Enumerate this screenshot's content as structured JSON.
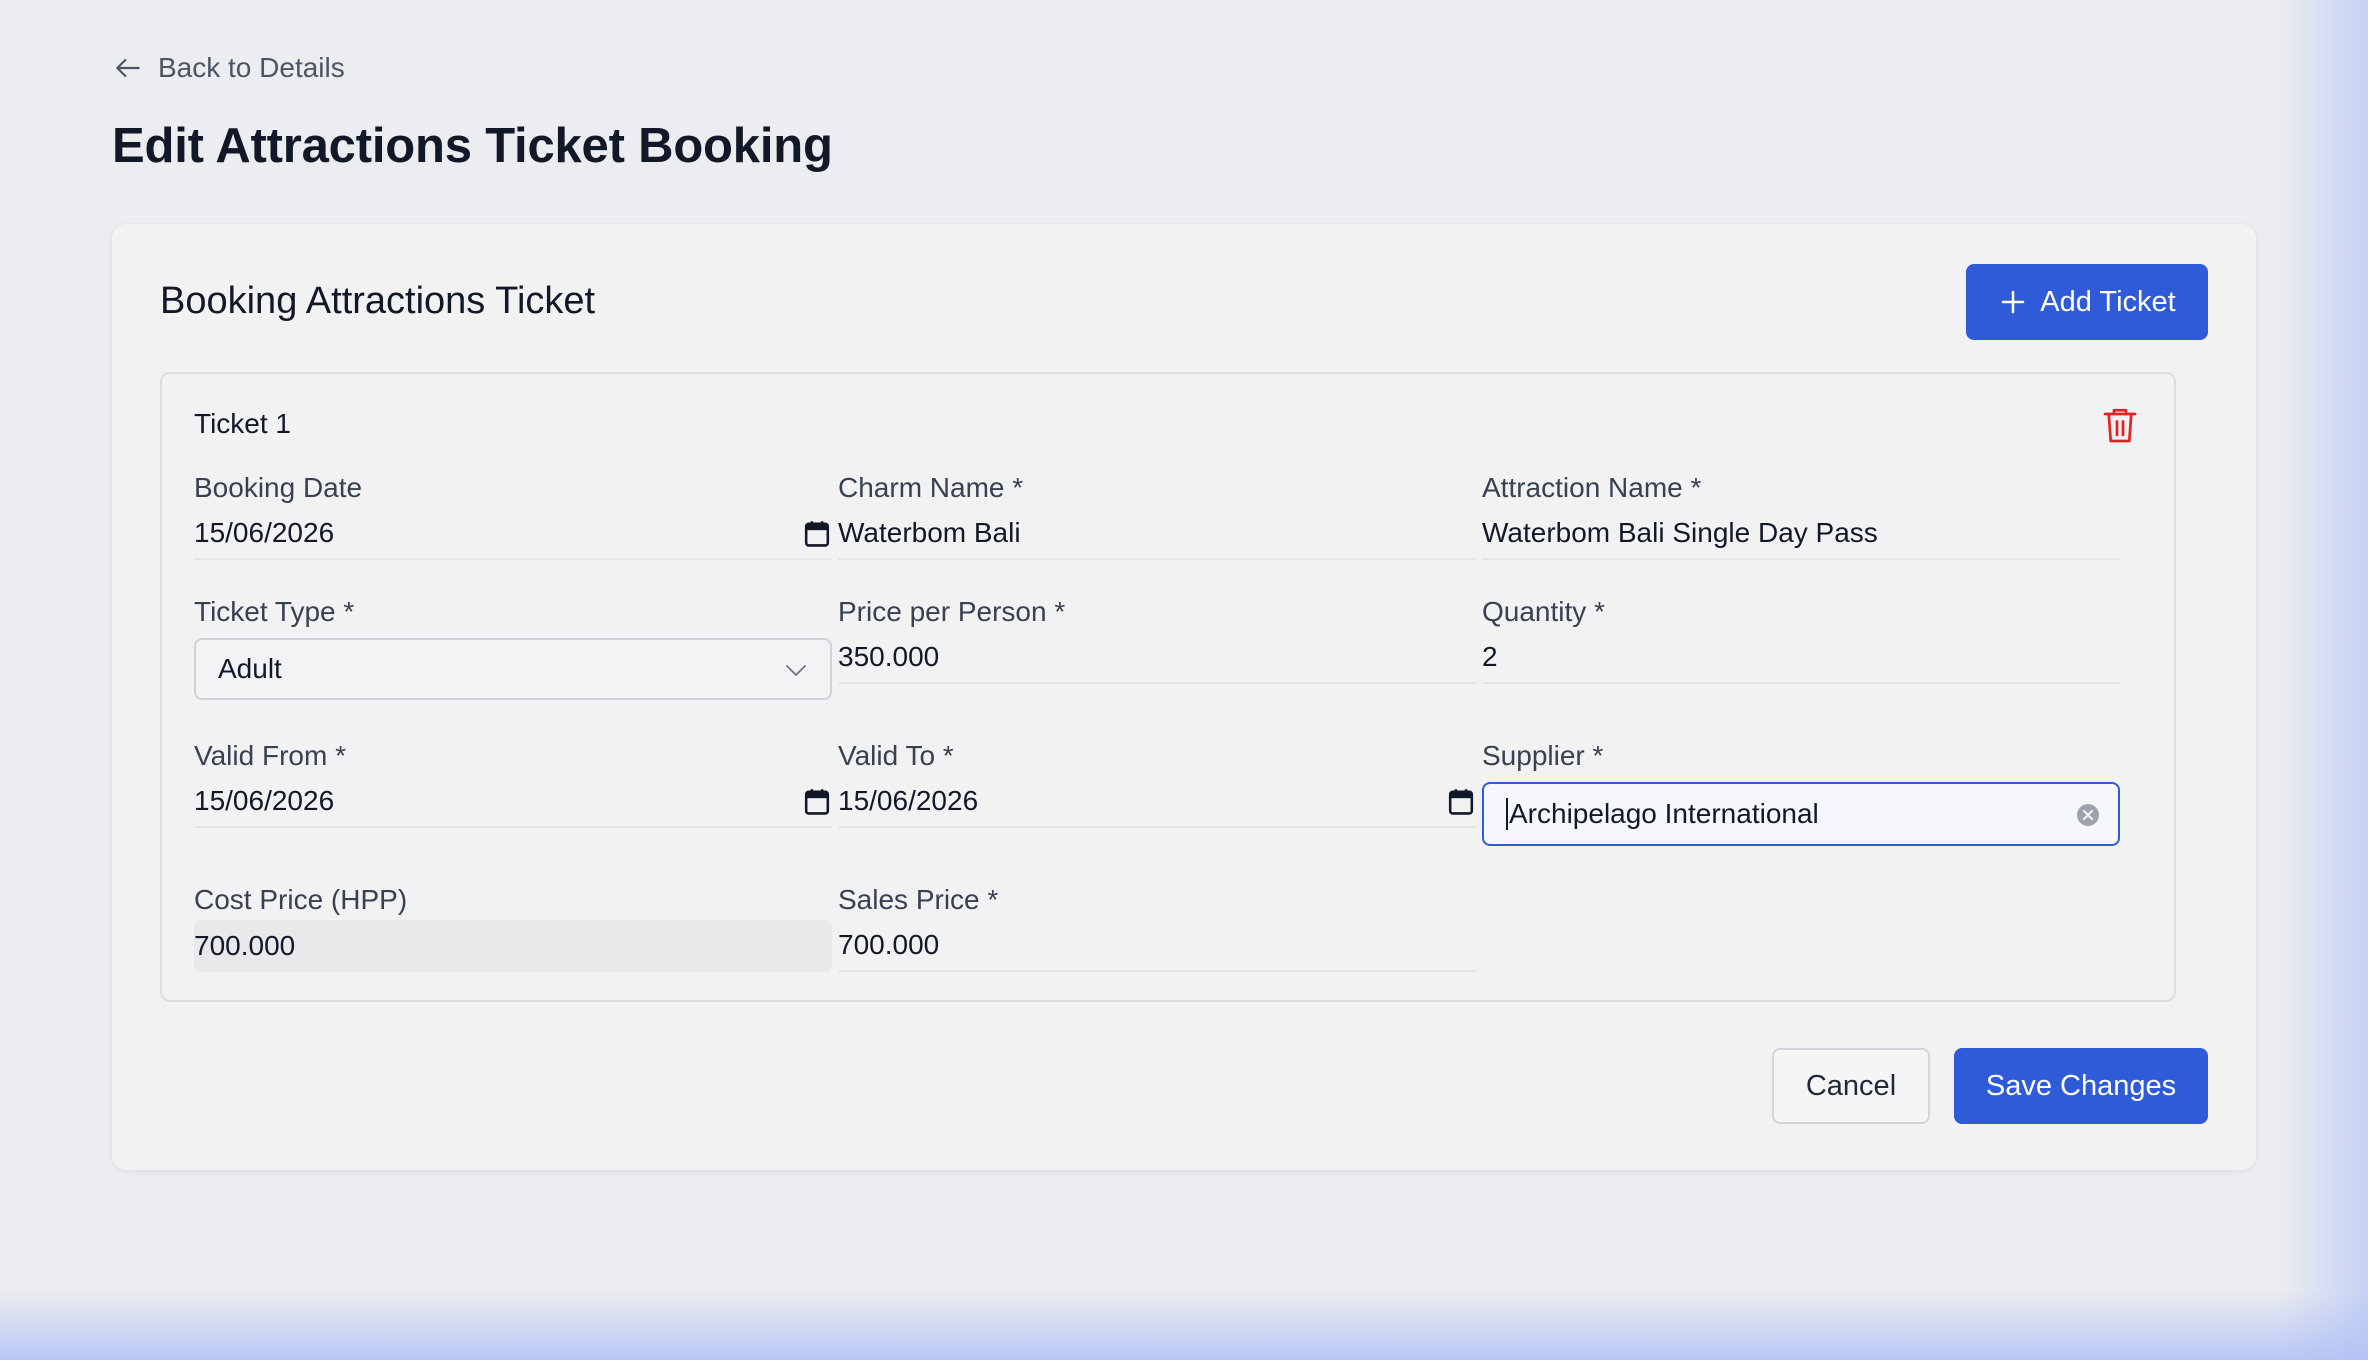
{
  "nav": {
    "back_label": "Back to Details"
  },
  "page": {
    "title": "Edit Attractions Ticket Booking"
  },
  "card": {
    "title": "Booking Attractions Ticket",
    "add_ticket_label": "Add Ticket"
  },
  "ticket": {
    "title": "Ticket 1",
    "booking_date": {
      "label": "Booking Date",
      "value": "15/06/2026"
    },
    "charm_name": {
      "label": "Charm Name *",
      "value": "Waterbom Bali"
    },
    "attraction_name": {
      "label": "Attraction Name *",
      "value": "Waterbom Bali Single Day Pass"
    },
    "ticket_type": {
      "label": "Ticket Type *",
      "value": "Adult"
    },
    "price_per_person": {
      "label": "Price per Person *",
      "value": "350.000"
    },
    "quantity": {
      "label": "Quantity *",
      "value": "2"
    },
    "valid_from": {
      "label": "Valid From *",
      "value": "15/06/2026"
    },
    "valid_to": {
      "label": "Valid To *",
      "value": "15/06/2026"
    },
    "supplier": {
      "label": "Supplier *",
      "value": "Archipelago International"
    },
    "cost_price": {
      "label": "Cost Price (HPP)",
      "value": "700.000"
    },
    "sales_price": {
      "label": "Sales Price *",
      "value": "700.000"
    }
  },
  "footer": {
    "cancel_label": "Cancel",
    "save_label": "Save Changes"
  },
  "icons": {
    "back": "arrow-left-icon",
    "add": "plus-icon",
    "delete": "trash-icon",
    "calendar": "calendar-icon",
    "dropdown": "chevron-down-icon",
    "clear": "clear-circle-icon"
  },
  "colors": {
    "primary": "#2f5bd8",
    "danger": "#dc2626",
    "background": "#ecedf0",
    "card": "#f2f2f3"
  }
}
